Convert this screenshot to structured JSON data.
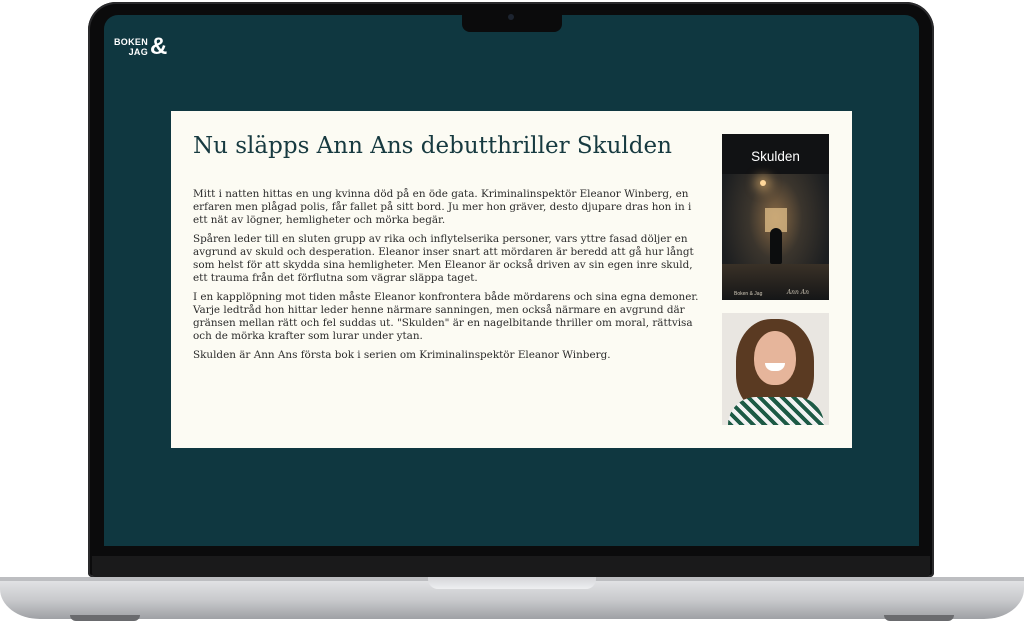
{
  "logo": {
    "line1": "BOKEN",
    "line2": "JAG",
    "symbol": "&"
  },
  "article": {
    "title": "Nu släpps Ann Ans debutthriller Skulden",
    "paragraphs": [
      "Mitt i natten hittas en ung kvinna död på en öde gata. Kriminalinspektör Eleanor Winberg, en erfaren men plågad polis, får fallet på sitt bord. Ju mer hon gräver, desto djupare dras hon in i ett nät av lögner, hemligheter och mörka begär.",
      "Spåren leder till en sluten grupp av rika och inflytelserika personer, vars yttre fasad döljer en avgrund av skuld och desperation. Eleanor inser snart att mördaren är beredd att gå hur långt som helst för att skydda sina hemligheter. Men Eleanor är också driven av sin egen inre skuld, ett trauma från det förflutna som vägrar släppa taget.",
      "I en kapplöpning mot tiden måste Eleanor konfrontera både mördarens och sina egna demoner. Varje ledtråd hon hittar leder henne närmare sanningen, men också närmare en avgrund där gränsen mellan rätt och fel suddas ut. \"Skulden\" är en nagelbitande thriller om moral, rättvisa och de mörka krafter som lurar under ytan.",
      "Skulden är Ann Ans första bok i serien om Kriminalinspektör Eleanor Winberg."
    ]
  },
  "cover": {
    "title": "Skulden",
    "author": "Ann An",
    "publisher_mark": "Boken & Jag"
  },
  "colors": {
    "screen_bg": "#0f3740",
    "card_bg": "#fcfbf3",
    "title": "#173a40"
  }
}
